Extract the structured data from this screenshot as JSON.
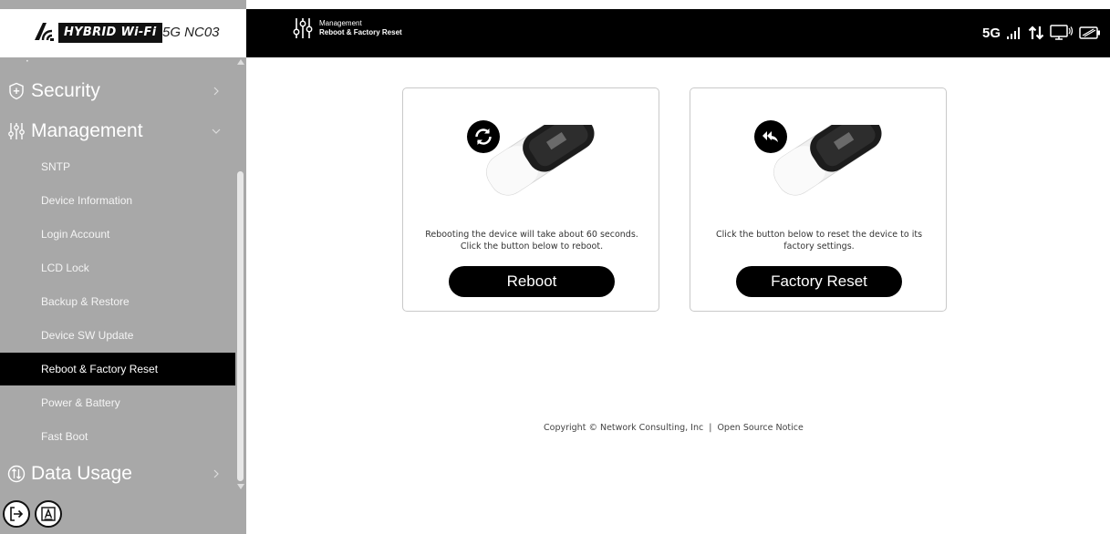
{
  "logo": {
    "badge": "HYBRID Wi-Fi",
    "model": "5G NC03"
  },
  "header": {
    "parent": "Management",
    "current": "Reboot & Factory Reset",
    "network": "5G"
  },
  "sidebar": {
    "dot": "·",
    "sections": [
      {
        "label": "Security",
        "icon": "shield-plus-icon",
        "chevron": "right"
      },
      {
        "label": "Management",
        "icon": "sliders-icon",
        "chevron": "down"
      },
      {
        "label": "Data Usage",
        "icon": "data-arrows-icon",
        "chevron": "right"
      }
    ],
    "items": [
      {
        "label": "SNTP"
      },
      {
        "label": "Device Information"
      },
      {
        "label": "Login Account"
      },
      {
        "label": "LCD Lock"
      },
      {
        "label": "Backup & Restore"
      },
      {
        "label": "Device SW Update"
      },
      {
        "label": "Reboot & Factory Reset",
        "active": true
      },
      {
        "label": "Power & Battery"
      },
      {
        "label": "Fast Boot"
      }
    ],
    "bottom_icons": [
      "logout-icon",
      "font-size-icon"
    ]
  },
  "cards": {
    "reboot": {
      "desc_line1": "Rebooting the device will take about 60 seconds.",
      "desc_line2": "Click the button below to reboot.",
      "button": "Reboot",
      "icon": "refresh-icon"
    },
    "factory": {
      "desc_line1": "Click the button below to reset the device to its",
      "desc_line2": "factory settings.",
      "button": "Factory Reset",
      "icon": "reply-all-icon"
    }
  },
  "footer": {
    "copyright": "Copyright © Network Consulting, Inc",
    "separator": "|",
    "link": "Open Source Notice"
  },
  "colors": {
    "sidebar_bg": "#a8a8a8",
    "active_bg": "#000000",
    "header_bg": "#000000",
    "button_bg": "#000000"
  }
}
